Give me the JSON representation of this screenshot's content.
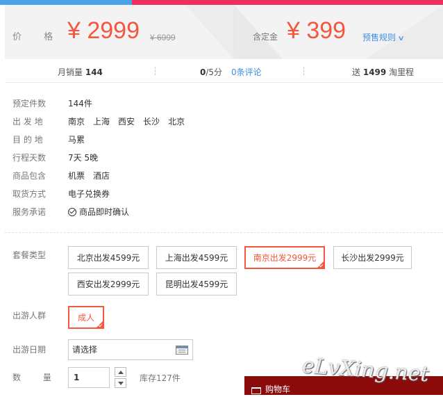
{
  "price": {
    "label": "价  格",
    "current": "¥ 2999",
    "original": "¥ 6999",
    "deposit_label": "含定金",
    "deposit": "¥ 399",
    "presale_rules": "预售规则"
  },
  "stats": {
    "sales_label": "月销量",
    "sales_value": "144",
    "rating_value": "0",
    "rating_suffix": "/5分",
    "reviews": "0条评论",
    "points_prefix": "送",
    "points_value": "1499",
    "points_suffix": "淘里程"
  },
  "info": [
    {
      "key": "预定件数",
      "values": [
        "144件"
      ]
    },
    {
      "key": "出 发 地",
      "values": [
        "南京",
        "上海",
        "西安",
        "长沙",
        "北京"
      ]
    },
    {
      "key": "目 的 地",
      "values": [
        "马累"
      ]
    },
    {
      "key": "行程天数",
      "values": [
        "7天 5晚"
      ]
    },
    {
      "key": "商品包含",
      "values": [
        "机票",
        "酒店"
      ]
    },
    {
      "key": "取货方式",
      "values": [
        "电子兑换券"
      ]
    },
    {
      "key": "服务承诺",
      "values": [
        "商品即时确认"
      ]
    }
  ],
  "package": {
    "label": "套餐类型",
    "options": [
      "北京出发4599元",
      "上海出发4599元",
      "南京出发2999元",
      "长沙出发2999元",
      "西安出发2999元",
      "昆明出发4599元"
    ],
    "selected": "南京出发2999元"
  },
  "travelers": {
    "label": "出游人群",
    "options": [
      "成人"
    ],
    "selected": "成人"
  },
  "date": {
    "label": "出游日期",
    "value": "请选择"
  },
  "quantity": {
    "label": "数  量",
    "value": "1",
    "stock": "库存127件"
  },
  "cart": {
    "label": "购物车"
  },
  "watermark": "eLvXing.net",
  "colors": {
    "accent": "#f5563e",
    "link": "#3a8ee6",
    "top_blue": "#4aa3e6",
    "top_red": "#ee2e5b",
    "cart_bg": "#8b0b0b"
  }
}
